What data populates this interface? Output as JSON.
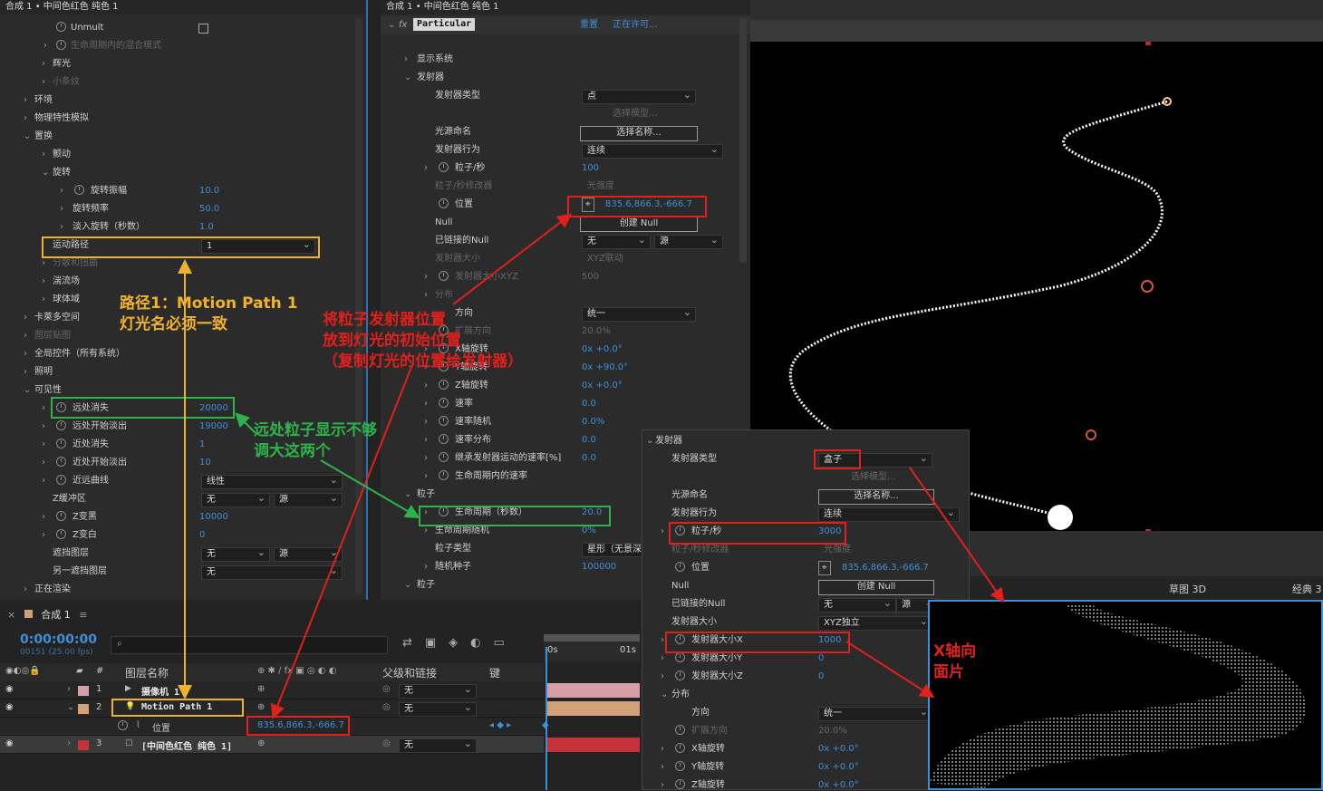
{
  "left_panel": {
    "title": "合成 1 • 中间色红色 纯色 1",
    "rows": [
      {
        "label": "Unmult"
      },
      {
        "label": "生命周期内的混合模式"
      },
      {
        "label": "辉光"
      },
      {
        "label": "小条纹"
      },
      {
        "label": "环境"
      },
      {
        "label": "物理特性模拟"
      },
      {
        "label": "置换"
      },
      {
        "label": "颤动"
      },
      {
        "label": "旋转"
      },
      {
        "label": "旋转振幅",
        "value": "10.0"
      },
      {
        "label": "旋转频率",
        "value": "50.0"
      },
      {
        "label": "淡入旋转（秒数）",
        "value": "1.0"
      },
      {
        "label": "运动路径",
        "value": "1"
      },
      {
        "label": "分散和扭曲"
      },
      {
        "label": "湍流场"
      },
      {
        "label": "球体域"
      },
      {
        "label": "卡萊多空间"
      },
      {
        "label": "图层贴图"
      },
      {
        "label": "全局控件（所有系统）"
      },
      {
        "label": "照明"
      },
      {
        "label": "可见性"
      },
      {
        "label": "远处消失",
        "value": "20000"
      },
      {
        "label": "远处开始淡出",
        "value": "19000"
      },
      {
        "label": "近处消失",
        "value": "1"
      },
      {
        "label": "近处开始淡出",
        "value": "10"
      },
      {
        "label": "近远曲线",
        "value": "线性"
      },
      {
        "label": "Z缓冲区",
        "value": "无",
        "value2": "源"
      },
      {
        "label": "Z变黑",
        "value": "10000"
      },
      {
        "label": "Z变白",
        "value": "0"
      },
      {
        "label": "遮挡图层",
        "value": "无",
        "value2": "源"
      },
      {
        "label": "另一遮挡图层",
        "value": "无"
      },
      {
        "label": "正在渲染"
      }
    ]
  },
  "mid_panel": {
    "title": "合成 1 • 中间色红色 纯色 1",
    "plugin": "Particular",
    "reset": "重置",
    "license": "正在许可...",
    "rows": [
      {
        "label": "显示系统"
      },
      {
        "label": "发射器"
      },
      {
        "label": "发射器类型",
        "value": "点"
      },
      {
        "label": "",
        "value": "选择模型..."
      },
      {
        "label": "光源命名",
        "value": "选择名称..."
      },
      {
        "label": "发射器行为",
        "value": "连续"
      },
      {
        "label": "粒子/秒",
        "value": "100"
      },
      {
        "label": "粒子/秒修改器",
        "value": "光强度"
      },
      {
        "label": "位置",
        "value": "835.6,866.3,-666.7"
      },
      {
        "label": "Null",
        "value": "创建 Null"
      },
      {
        "label": "已链接的Null",
        "value": "无",
        "value2": "源"
      },
      {
        "label": "发射器大小",
        "value": "XYZ联动"
      },
      {
        "label": "发射器大小XYZ",
        "value": "500"
      },
      {
        "label": "分布"
      },
      {
        "label": "方向",
        "value": "统一"
      },
      {
        "label": "扩展方向",
        "value": "20.0%"
      },
      {
        "label": "X轴旋转",
        "value": "0x +0.0°"
      },
      {
        "label": "Y轴旋转",
        "value": "0x +90.0°"
      },
      {
        "label": "Z轴旋转",
        "value": "0x +0.0°"
      },
      {
        "label": "速率",
        "value": "0.0"
      },
      {
        "label": "速率随机",
        "value": "0.0%"
      },
      {
        "label": "速率分布",
        "value": "0.0"
      },
      {
        "label": "继承发射器运动的速率[%]",
        "value": "0.0"
      },
      {
        "label": "生命周期内的速率"
      },
      {
        "label": "粒子"
      },
      {
        "label": "生命周期（秒数）",
        "value": "20.0"
      },
      {
        "label": "生命周期随机",
        "value": "0%"
      },
      {
        "label": "粒子类型",
        "value": "星形（无景深）"
      },
      {
        "label": "随机种子",
        "value": "100000"
      },
      {
        "label": "粒子"
      }
    ]
  },
  "popup_panel": {
    "rows": [
      {
        "label": "发射器"
      },
      {
        "label": "发射器类型",
        "value": "盒子"
      },
      {
        "label": "",
        "value": "选择模型..."
      },
      {
        "label": "光源命名",
        "value": "选择名称..."
      },
      {
        "label": "发射器行为",
        "value": "连续"
      },
      {
        "label": "粒子/秒",
        "value": "3000"
      },
      {
        "label": "粒子/秒修改器",
        "value": "光强度"
      },
      {
        "label": "位置",
        "value": "835.6,866.3,-666.7"
      },
      {
        "label": "Null",
        "value": "创建 Null"
      },
      {
        "label": "已链接的Null",
        "value": "无",
        "value2": "源"
      },
      {
        "label": "发射器大小",
        "value": "XYZ独立"
      },
      {
        "label": "发射器大小X",
        "value": "1000"
      },
      {
        "label": "发射器大小Y",
        "value": "0"
      },
      {
        "label": "发射器大小Z",
        "value": "0"
      },
      {
        "label": "分布"
      },
      {
        "label": "方向",
        "value": "统一"
      },
      {
        "label": "扩展方向",
        "value": "20.0%"
      },
      {
        "label": "X轴旋转",
        "value": "0x +0.0°"
      },
      {
        "label": "Y轴旋转",
        "value": "0x +0.0°"
      },
      {
        "label": "Z轴旋转",
        "value": "0x +0.0°"
      }
    ]
  },
  "viewer": {
    "draft3d": "草图 3D",
    "classic": "经典 3"
  },
  "timeline": {
    "tab": "合成 1",
    "timecode": "0:00:00:00",
    "frames": "00151 (25.00 fps)",
    "col_layer": "图层名称",
    "col_parent": "父级和链接",
    "col_key": "键",
    "col_num": "#",
    "ruler": [
      "0s",
      "01s"
    ],
    "layers": [
      {
        "num": "1",
        "name": "摄像机 1",
        "parent": "无"
      },
      {
        "num": "2",
        "name": "Motion Path 1",
        "parent": "无"
      },
      {
        "num": "",
        "name": "位置",
        "value": "835.6,866.3,-666.7"
      },
      {
        "num": "3",
        "name": "[中间色红色 纯色 1]",
        "parent": "无"
      }
    ]
  },
  "annotations": {
    "a1": "路径1：Motion Path 1",
    "a1b": "灯光名必须一致",
    "a2": "将粒子发射器位置",
    "a2b": "放到灯光的初始位置",
    "a2c": "（复制灯光的位置给发射器）",
    "a3": "远处粒子显示不够",
    "a3b": "调大这两个",
    "a4": "X轴向",
    "a4b": "面片"
  },
  "colors": {
    "accent": "#3d8fd6",
    "red": "#e0201c",
    "yellow": "#f0b22a",
    "green": "#2db34a"
  }
}
